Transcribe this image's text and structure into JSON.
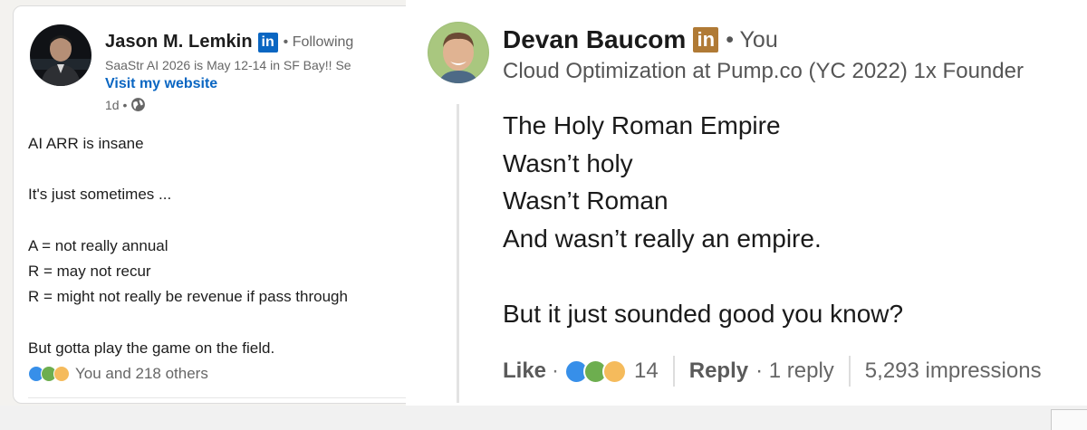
{
  "left_post": {
    "author_name": "Jason M. Lemkin",
    "linkedin_badge": "in",
    "follow_status": "• Following",
    "headline": "SaaStr AI 2026 is May 12-14 in SF Bay!! Se",
    "visit_link": "Visit my website",
    "time": "1d •",
    "body_lines": [
      "AI ARR is insane",
      "",
      "It's just sometimes ...",
      "",
      "A = not really annual",
      "R = may not recur",
      "R = might not really be revenue if pass through",
      "",
      "But gotta play the game on the field."
    ],
    "reactions_text": "You and 218 others"
  },
  "right_comment": {
    "author_name": "Devan Baucom",
    "linkedin_badge": "in",
    "you_label": "• You",
    "headline": "Cloud Optimization at Pump.co (YC 2022) 1x Founder",
    "body_lines": [
      "The Holy Roman Empire",
      "Wasn’t holy",
      "Wasn’t Roman",
      "And wasn’t really an empire.",
      "",
      "But it just sounded good you know?"
    ],
    "like_label": "Like",
    "reaction_count": "14",
    "reply_label": "Reply",
    "replies": "· 1 reply",
    "impressions": "5,293 impressions"
  },
  "colors": {
    "linkedin_blue": "#0a66c2",
    "linkedin_gold": "#b07a35",
    "like_blue": "#378fe9",
    "celebrate_green": "#6dae4f",
    "insight_yellow": "#f5bb5c"
  },
  "icons": [
    "globe-icon",
    "like-reaction-icon",
    "celebrate-reaction-icon",
    "insightful-reaction-icon"
  ]
}
